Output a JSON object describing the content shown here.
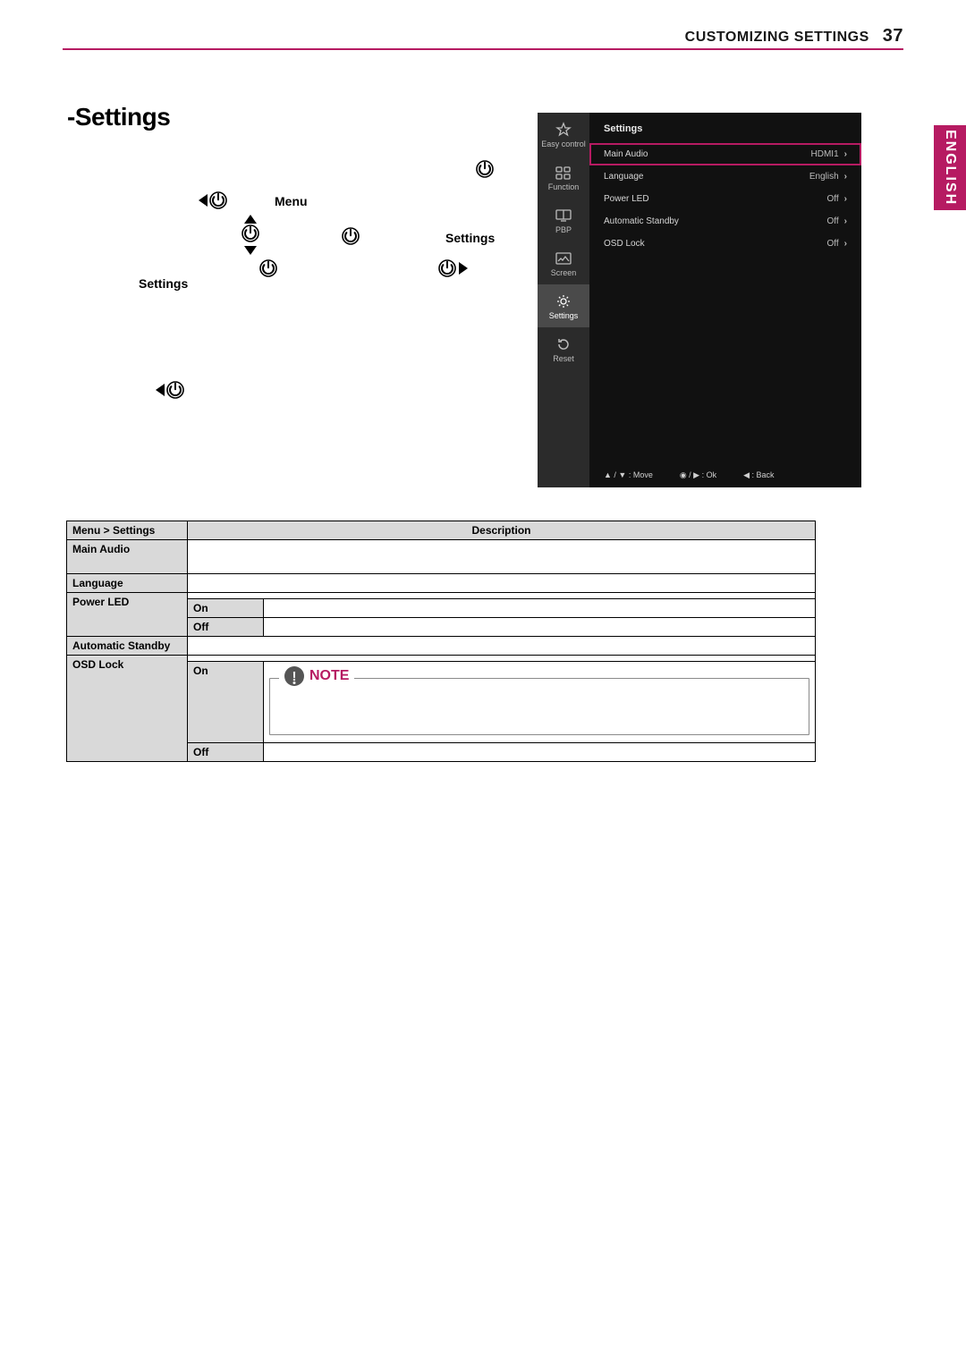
{
  "header": {
    "section": "CUSTOMIZING SETTINGS",
    "page": "37"
  },
  "language_tab": "ENGLISH",
  "section_title": "-Settings",
  "floaters": {
    "menu": "Menu",
    "settings_right": "Settings",
    "settings_left": "Settings"
  },
  "osd": {
    "title": "Settings",
    "sidebar": [
      {
        "label": "Easy control"
      },
      {
        "label": "Function"
      },
      {
        "label": "PBP"
      },
      {
        "label": "Screen"
      },
      {
        "label": "Settings"
      },
      {
        "label": "Reset"
      }
    ],
    "rows": [
      {
        "label": "Main Audio",
        "value": "HDMI1",
        "selected": true
      },
      {
        "label": "Language",
        "value": "English",
        "selected": false
      },
      {
        "label": "Power LED",
        "value": "Off",
        "selected": false
      },
      {
        "label": "Automatic Standby",
        "value": "Off",
        "selected": false
      },
      {
        "label": "OSD Lock",
        "value": "Off",
        "selected": false
      }
    ],
    "footer": {
      "move": "▲ / ▼ : Move",
      "ok": "◉ / ▶  :  Ok",
      "back": "◀  : Back"
    }
  },
  "table": {
    "headers": {
      "menu": "Menu > Settings",
      "desc": "Description"
    },
    "rows": {
      "main_audio": "Main Audio",
      "language": "Language",
      "power_led": "Power LED",
      "on": "On",
      "off": "Off",
      "auto_standby": "Automatic Standby",
      "osd_lock": "OSD Lock"
    },
    "note_label": "NOTE"
  }
}
